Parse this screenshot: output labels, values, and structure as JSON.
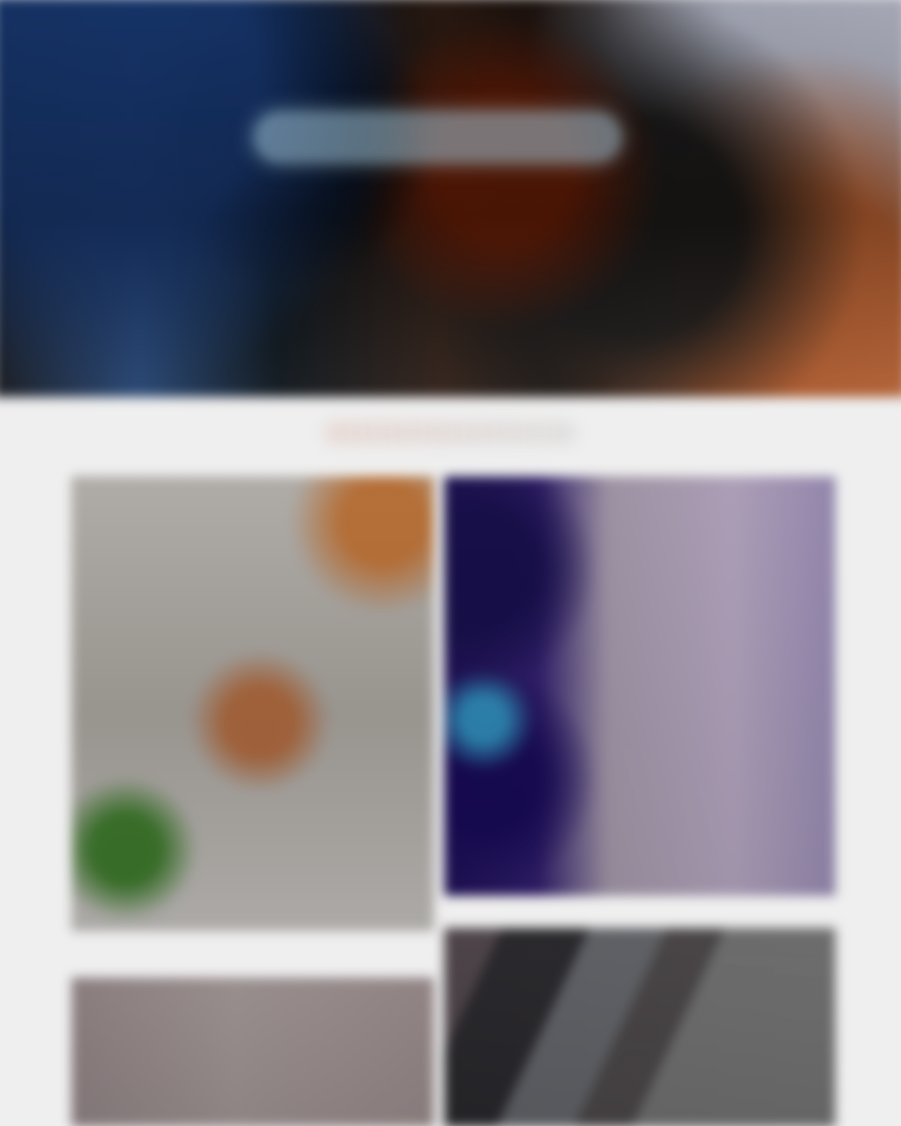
{
  "page": {
    "hero": {},
    "section": {},
    "gallery": {
      "items": [
        {},
        {},
        {},
        {}
      ]
    }
  }
}
